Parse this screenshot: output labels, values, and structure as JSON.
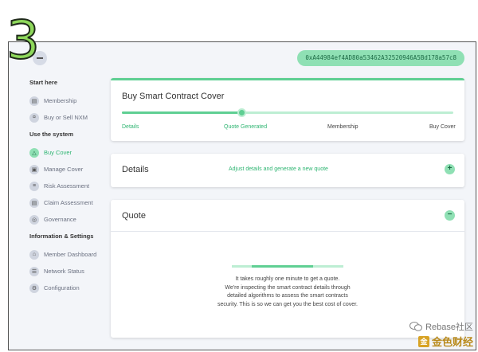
{
  "step_number": "3",
  "wallet": {
    "address": "0xA44984ef4AD80a53462A32520946A5Bd178a57c8"
  },
  "sidebar": {
    "groups": [
      {
        "heading": "Start here",
        "items": [
          {
            "label": "Membership",
            "icon": "membership-icon",
            "glyph": "▤"
          },
          {
            "label": "Buy or Sell NXM",
            "icon": "coin-icon",
            "glyph": "¤"
          }
        ]
      },
      {
        "heading": "Use the system",
        "items": [
          {
            "label": "Buy Cover",
            "icon": "shield-icon",
            "glyph": "△",
            "active": true
          },
          {
            "label": "Manage Cover",
            "icon": "briefcase-icon",
            "glyph": "▣"
          },
          {
            "label": "Risk Assessment",
            "icon": "document-icon",
            "glyph": "≡"
          },
          {
            "label": "Claim Assessment",
            "icon": "clipboard-icon",
            "glyph": "▤"
          },
          {
            "label": "Governance",
            "icon": "globe-icon",
            "glyph": "◎"
          }
        ]
      },
      {
        "heading": "Information & Settings",
        "items": [
          {
            "label": "Member Dashboard",
            "icon": "home-icon",
            "glyph": "⌂"
          },
          {
            "label": "Network Status",
            "icon": "server-icon",
            "glyph": "☰"
          },
          {
            "label": "Configuration",
            "icon": "settings-icon",
            "glyph": "⚙"
          }
        ]
      }
    ]
  },
  "progress_card": {
    "title": "Buy Smart Contract Cover",
    "progress_fraction": 0.36,
    "steps": [
      {
        "label": "Details",
        "done": true
      },
      {
        "label": "Quote Generated",
        "done": true
      },
      {
        "label": "Membership",
        "done": false
      },
      {
        "label": "Buy Cover",
        "done": false
      }
    ]
  },
  "details_card": {
    "title": "Details",
    "hint": "Adjust details and generate a new quote",
    "toggle": "+"
  },
  "quote_card": {
    "title": "Quote",
    "toggle": "−",
    "loading_fraction": 0.55,
    "message_lines": [
      "It takes roughly one minute to get a quote.",
      "We're inspecting the smart contract details through",
      "detailed algorithms to assess the smart contracts",
      "security. This is so we can get you the best cost of cover."
    ]
  },
  "colors": {
    "accent": "#5fcf93",
    "accent_light": "#bdeed3",
    "accent_text": "#2fb572",
    "background": "#f3f5f9"
  },
  "watermark": {
    "line1": "Rebase社区",
    "line2": "金色财经",
    "logo_glyph": "金"
  }
}
